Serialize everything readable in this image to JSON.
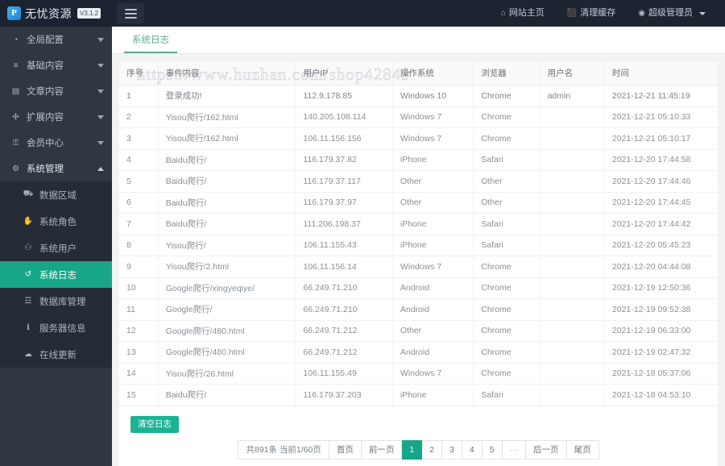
{
  "brand": {
    "logo_letter": "P",
    "name": "无忧资源",
    "version": "V3.1.2"
  },
  "topnav": [
    {
      "icon": "home-icon",
      "glyph": "⌂",
      "label": "网站主页"
    },
    {
      "icon": "trash-icon",
      "glyph": "⬛",
      "label": "清理缓存"
    },
    {
      "icon": "user-circle-icon",
      "glyph": "◉",
      "label": "超级管理员"
    }
  ],
  "sidebar": {
    "items": [
      {
        "icon": "globe-icon",
        "glyph": "◔",
        "label": "全局配置",
        "expanded": false
      },
      {
        "icon": "list-icon",
        "glyph": "≡",
        "label": "基础内容",
        "expanded": false
      },
      {
        "icon": "document-icon",
        "glyph": "▤",
        "label": "文章内容",
        "expanded": false
      },
      {
        "icon": "puzzle-icon",
        "glyph": "✣",
        "label": "扩展内容",
        "expanded": false
      },
      {
        "icon": "lock-icon",
        "glyph": "⚿",
        "label": "会员中心",
        "expanded": false
      },
      {
        "icon": "gear-icon",
        "glyph": "⚙",
        "label": "系统管理",
        "expanded": true
      }
    ],
    "submenu": [
      {
        "icon": "sitemap-icon",
        "glyph": "⛟",
        "label": "数据区域",
        "active": false
      },
      {
        "icon": "hand-icon",
        "glyph": "✋",
        "label": "系统角色",
        "active": false
      },
      {
        "icon": "users-icon",
        "glyph": "⚇",
        "label": "系统用户",
        "active": false
      },
      {
        "icon": "history-icon",
        "glyph": "↺",
        "label": "系统日志",
        "active": true
      },
      {
        "icon": "database-icon",
        "glyph": "☲",
        "label": "数据库管理",
        "active": false
      },
      {
        "icon": "info-icon",
        "glyph": "ℹ",
        "label": "服务器信息",
        "active": false
      },
      {
        "icon": "cloud-upload-icon",
        "glyph": "☁",
        "label": "在线更新",
        "active": false
      }
    ]
  },
  "tabs": [
    {
      "label": "系统日志",
      "active": true
    }
  ],
  "watermark": "https://www.huzhan.com/shop42849",
  "table": {
    "headers": [
      "序号",
      "事件内容",
      "用户IP",
      "操作系统",
      "浏览器",
      "用户名",
      "时间"
    ],
    "rows": [
      [
        "1",
        "登录成功!",
        "112.9.178.85",
        "Windows 10",
        "Chrome",
        "admin",
        "2021-12-21 11:45:19"
      ],
      [
        "2",
        "Yisou爬行/162.html",
        "140.205.108.114",
        "Windows 7",
        "Chrome",
        "",
        "2021-12-21 05:10:33"
      ],
      [
        "3",
        "Yisou爬行/162.html",
        "106.11.156.156",
        "Windows 7",
        "Chrome",
        "",
        "2021-12-21 05:10:17"
      ],
      [
        "4",
        "Baidu爬行/",
        "116.179.37.82",
        "iPhone",
        "Safari",
        "",
        "2021-12-20 17:44:58"
      ],
      [
        "5",
        "Baidu爬行/",
        "116.179.37.117",
        "Other",
        "Other",
        "",
        "2021-12-20 17:44:46"
      ],
      [
        "6",
        "Baidu爬行/",
        "116.179.37.97",
        "Other",
        "Other",
        "",
        "2021-12-20 17:44:45"
      ],
      [
        "7",
        "Baidu爬行/",
        "111.206.198.37",
        "iPhone",
        "Safari",
        "",
        "2021-12-20 17:44:42"
      ],
      [
        "8",
        "Yisou爬行/",
        "106.11.155.43",
        "iPhone",
        "Safari",
        "",
        "2021-12-20 05:45:23"
      ],
      [
        "9",
        "Yisou爬行/2.html",
        "106.11.156.14",
        "Windows 7",
        "Chrome",
        "",
        "2021-12-20 04:44:08"
      ],
      [
        "10",
        "Google爬行/xingyeqiye/",
        "66.249.71.210",
        "Android",
        "Chrome",
        "",
        "2021-12-19 12:50:36"
      ],
      [
        "11",
        "Google爬行/",
        "66.249.71.210",
        "Android",
        "Chrome",
        "",
        "2021-12-19 09:52:38"
      ],
      [
        "12",
        "Google爬行/480.html",
        "66.249.71.212",
        "Other",
        "Chrome",
        "",
        "2021-12-19 06:33:00"
      ],
      [
        "13",
        "Google爬行/480.html",
        "66.249.71.212",
        "Android",
        "Chrome",
        "",
        "2021-12-19 02:47:32"
      ],
      [
        "14",
        "Yisou爬行/26.html",
        "106.11.155.49",
        "Windows 7",
        "Chrome",
        "",
        "2021-12-18 05:37:06"
      ],
      [
        "15",
        "Baidu爬行/",
        "116.179.37.203",
        "iPhone",
        "Safari",
        "",
        "2021-12-18 04:53:10"
      ]
    ]
  },
  "actions": {
    "clear_log_label": "清空日志"
  },
  "pagination": {
    "info": "共891条 当前1/60页",
    "first": "首页",
    "prev": "前一页",
    "pages": [
      "1",
      "2",
      "3",
      "4",
      "5"
    ],
    "active_page": "1",
    "dots": "···",
    "next": "后一页",
    "last": "尾页"
  },
  "colors": {
    "accent": "#1ab394",
    "active_nav": "#18a689",
    "topbar": "#1d2330",
    "sidebar": "#2f3741",
    "submenu": "#262c35"
  }
}
